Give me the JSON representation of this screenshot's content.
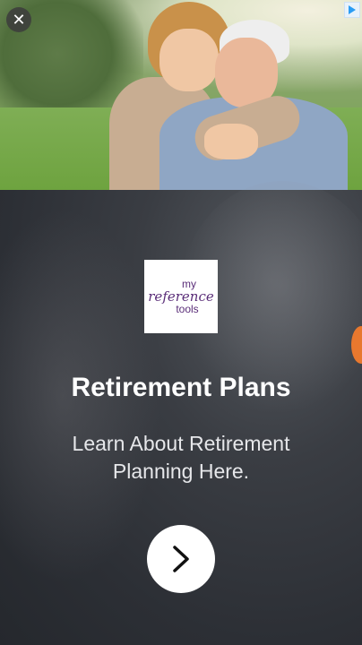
{
  "ad": {
    "close_label": "✕",
    "logo": {
      "line1": "my",
      "line2": "reference",
      "line3": "tools"
    },
    "headline": "Retirement Plans",
    "subline": "Learn About Retirement Planning Here.",
    "cta_icon": "chevron-right-icon",
    "colors": {
      "panel": "#2c2f35",
      "logo_text": "#5a2d78",
      "cta_bg": "#ffffff"
    }
  }
}
